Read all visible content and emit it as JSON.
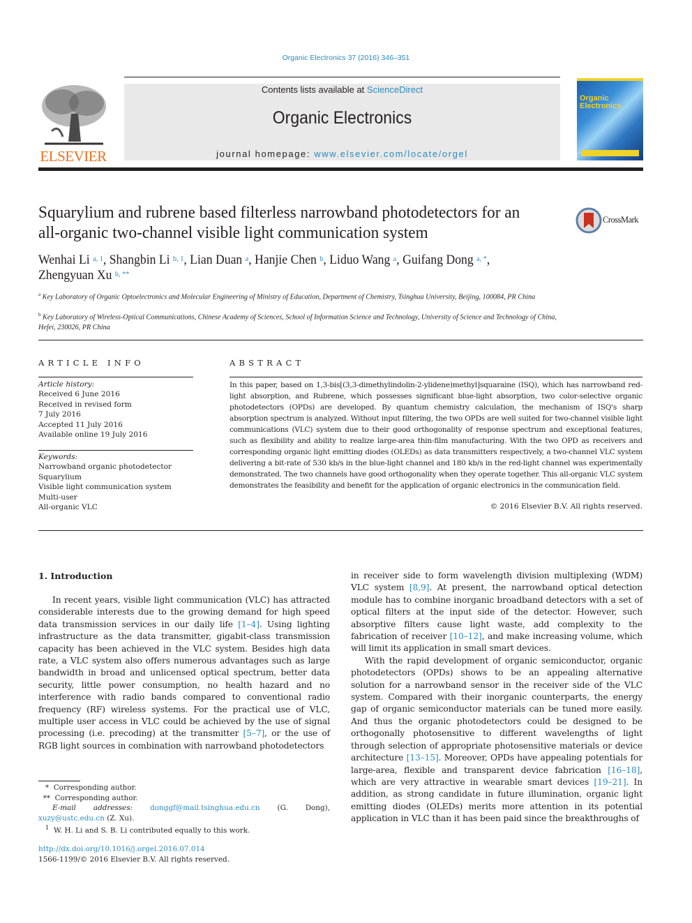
{
  "header": {
    "citation": "Organic Electronics 37 (2016) 346–351",
    "contents_prefix": "Contents lists available at ",
    "contents_link": "ScienceDirect",
    "journal_name": "Organic Electronics",
    "homepage_prefix": "journal homepage: ",
    "homepage_link": "www.elsevier.com/locate/orgel",
    "publisher_logo": "ELSEVIER",
    "cover_title_line1": "Organic",
    "cover_title_line2": "Electronics",
    "crossmark": "CrossMark"
  },
  "article": {
    "title": "Squarylium and rubrene based filterless narrowband photodetectors for an all-organic two-channel visible light communication system",
    "authors": [
      {
        "name": "Wenhai Li",
        "sup": "a, 1"
      },
      {
        "name": "Shangbin Li",
        "sup": "b, 1"
      },
      {
        "name": "Lian Duan",
        "sup": "a"
      },
      {
        "name": "Hanjie Chen",
        "sup": "b"
      },
      {
        "name": "Liduo Wang",
        "sup": "a"
      },
      {
        "name": "Guifang Dong",
        "sup": "a, *"
      },
      {
        "name": "Zhengyuan Xu",
        "sup": "b, **"
      }
    ],
    "affiliations": [
      {
        "mark": "a",
        "text": "Key Laboratory of Organic Optoelectronics and Molecular Engineering of Ministry of Education, Department of Chemistry, Tsinghua University, Beijing, 100084, PR China"
      },
      {
        "mark": "b",
        "text": "Key Laboratory of Wireless-Optical Communications, Chinese Academy of Sciences, School of Information Science and Technology, University of Science and Technology of China, Hefei, 230026, PR China"
      }
    ]
  },
  "article_info": {
    "heading": "ARTICLE INFO",
    "history_label": "Article history:",
    "history": [
      "Received 6 June 2016",
      "Received in revised form",
      "7 July 2016",
      "Accepted 11 July 2016",
      "Available online 19 July 2016"
    ],
    "keywords_label": "Keywords:",
    "keywords": [
      "Narrowband organic photodetector",
      "Squarylium",
      "Visible light communication system",
      "Multi-user",
      "All-organic VLC"
    ]
  },
  "abstract": {
    "heading": "ABSTRACT",
    "text": "In this paper, based on 1,3-bis[(3,3-dimethylindolin-2-ylidene)methyl]squaraine (ISQ), which has narrowband red-light absorption, and Rubrene, which possesses significant blue-light absorption, two color-selective organic photodetectors (OPDs) are developed. By quantum chemistry calculation, the mechanism of ISQ's sharp absorption spectrum is analyzed. Without input filtering, the two OPDs are well suited for two-channel visible light communications (VLC) system due to their good orthogonality of response spectrum and exceptional features, such as flexibility and ability to realize large-area thin-film manufacturing. With the two OPD as receivers and corresponding organic light emitting diodes (OLEDs) as data transmitters respectively, a two-channel VLC system delivering a bit-rate of 530 kb/s in the blue-light channel and 180 kb/s in the red-light channel was experimentally demonstrated. The two channels have good orthogonality when they operate together. This all-organic VLC system demonstrates the feasibility and benefit for the application of organic electronics in the communication field.",
    "copyright": "© 2016 Elsevier B.V. All rights reserved."
  },
  "introduction": {
    "heading": "1.  Introduction",
    "left_p1": [
      "In recent years, visible light communication (VLC) has attracted considerable interests due to the growing demand for high speed data transmission services in our daily life ",
      "[1–4]",
      ". Using lighting infrastructure as the data transmitter, gigabit-class transmission capacity has been achieved in the VLC system. Besides high data rate, a VLC system also offers numerous advantages such as large bandwidth in broad and unlicensed optical spectrum, better data security, little power consumption, no health hazard and no interference with radio bands compared to conventional radio frequency (RF) wireless systems. For the practical use of VLC, multiple user access in VLC could be achieved by the use of signal processing (i.e. precoding) at the transmitter ",
      "[5–7]",
      ", or the use of RGB light sources in combination with narrowband photodetectors"
    ],
    "right_p1": [
      "in receiver side to form wavelength division multiplexing (WDM) VLC system ",
      "[8,9]",
      ". At present, the narrowband optical detection module has to combine inorganic broadband detectors with a set of optical filters at the input side of the detector. However, such absorptive filters cause light waste, add complexity to the fabrication of receiver ",
      "[10–12]",
      ", and make increasing volume, which will limit its application in small smart devices."
    ],
    "right_p2": [
      "With the rapid development of organic semiconductor, organic photodetectors (OPDs) shows to be an appealing alternative solution for a narrowband sensor in the receiver side of the VLC system. Compared with their inorganic counterparts, the energy gap of organic semiconductor materials can be tuned more easily. And thus the organic photodetectors could be designed to be orthogonally photosensitive to different wavelengths of light through selection of appropriate photosensitive materials or device architecture ",
      "[13–15]",
      ". Moreover, OPDs have appealing potentials for large-area, flexible and transparent device fabrication ",
      "[16–18]",
      ", which are very attractive in wearable smart devices ",
      "[19–21]",
      ". In addition, as strong candidate in future illumination, organic light emitting diodes (OLEDs) merits more attention in its potential application in VLC than it has been paid since the breakthroughs of"
    ]
  },
  "footnotes": {
    "star1_mark": "*",
    "star1_text": "Corresponding author.",
    "star2_mark": "**",
    "star2_text": "Corresponding author.",
    "email_label": "E-mail addresses:",
    "email1": "donggf@mail.tsinghua.edu.cn",
    "email1_who": " (G. Dong), ",
    "email2": "xuzy@ustc.edu.cn",
    "email2_who": " (Z. Xu).",
    "note1_mark": "1",
    "note1_text": "W. H. Li and S. B. Li contributed equally to this work.",
    "doi": "http://dx.doi.org/10.1016/j.orgel.2016.07.014",
    "issn": "1566-1199/© 2016 Elsevier B.V. All rights reserved."
  }
}
